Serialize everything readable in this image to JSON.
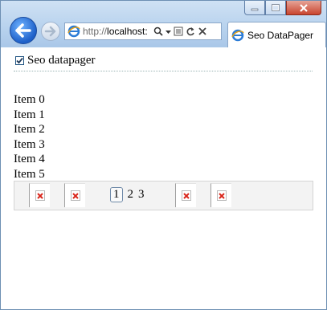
{
  "browser": {
    "address": {
      "url_prefix": "http://",
      "url_host": "localhost:"
    },
    "tab": {
      "title": "Seo DataPager"
    },
    "icons": {
      "back": "back-arrow-icon",
      "forward": "forward-arrow-icon",
      "ie": "ie-logo-icon",
      "search": "search-icon",
      "dropdown": "chevron-down-icon",
      "compat": "compatibility-view-icon",
      "refresh": "refresh-icon",
      "stop": "stop-icon"
    },
    "colors": {
      "accent": "#1d5fc8",
      "close": "#c9452f"
    }
  },
  "page": {
    "checkbox": {
      "label": "Seo datapager",
      "checked": true
    },
    "items": [
      "Item 0",
      "Item 1",
      "Item 2",
      "Item 3",
      "Item 4",
      "Item 5"
    ],
    "pager": {
      "pages": [
        "1",
        "2",
        "3"
      ],
      "current": "1",
      "nav_icons": [
        "broken-image-icon",
        "broken-image-icon",
        "broken-image-icon",
        "broken-image-icon"
      ]
    }
  }
}
